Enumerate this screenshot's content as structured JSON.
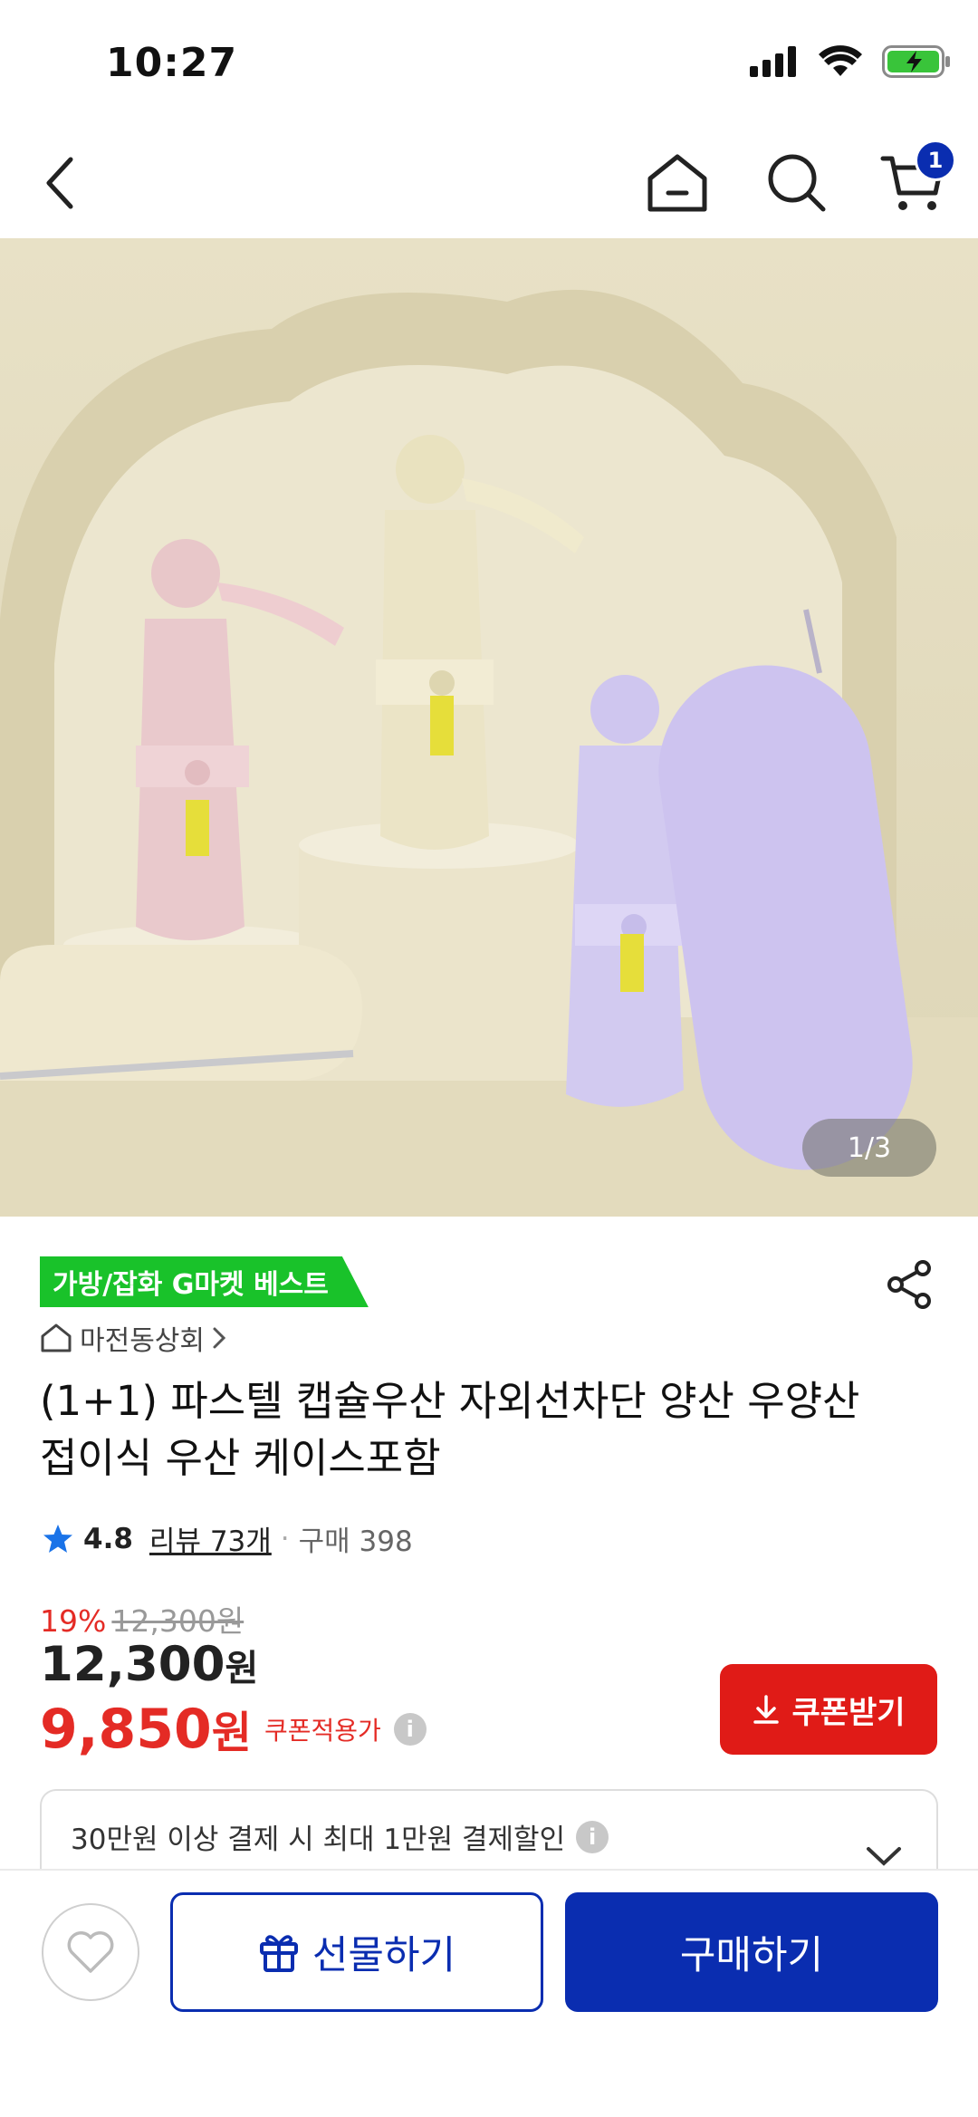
{
  "status_bar": {
    "time": "10:27"
  },
  "nav": {
    "cart_count": "1"
  },
  "gallery": {
    "counter": "1/3"
  },
  "product": {
    "badge": "가방/잡화 G마켓 베스트",
    "store": "마전동상회",
    "title": "(1+1) 파스텔 캡슐우산 자외선차단 양산 우양산 접이식 우산 케이스포함",
    "rating": "4.8",
    "review_label": "리뷰 73개",
    "purchase_label": "구매 398",
    "discount_rate": "19%",
    "original_price": "12,300원",
    "price_number": "12,300",
    "price_unit": "원",
    "coupon_price_number": "9,850",
    "coupon_price_unit": "원",
    "coupon_price_label": "쿠폰적용가",
    "coupon_button": "쿠폰받기"
  },
  "promo": {
    "text": "30만원 이상 결제 시 최대 1만원 결제할인"
  },
  "bottom": {
    "gift_label": "선물하기",
    "buy_label": "구매하기"
  },
  "colors": {
    "brand_blue": "#0a2db0",
    "sale_red": "#e42b25",
    "best_green": "#19c22a"
  }
}
